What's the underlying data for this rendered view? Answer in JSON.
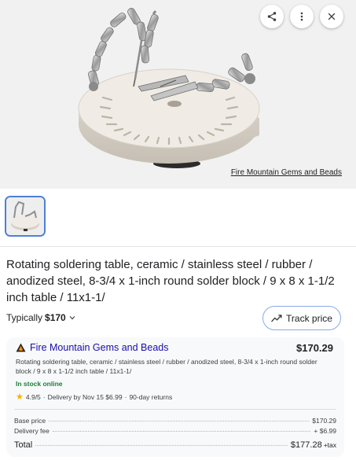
{
  "hero": {
    "image_credit": "Fire Mountain Gems and Beads",
    "actions": [
      {
        "name": "share",
        "icon": "share-icon"
      },
      {
        "name": "more",
        "icon": "more-vert-icon"
      },
      {
        "name": "close",
        "icon": "close-icon"
      }
    ]
  },
  "product": {
    "title": "Rotating soldering table, ceramic / stainless steel / rubber / anodized steel, 8-3/4 x 1-inch round solder block / 9 x 8 x 1-1/2 inch table / 11x1-1/",
    "typically_label": "Typically",
    "typically_price": "$170",
    "track_price_label": "Track price"
  },
  "offer": {
    "seller": "Fire Mountain Gems and Beads",
    "price": "$170.29",
    "description": "Rotating soldering table, ceramic / stainless steel / rubber / anodized steel, 8-3/4 x 1-inch round solder block / 9 x 8 x 1-1/2 inch table / 11x1-1/",
    "stock": "In stock online",
    "rating": "4.9/5",
    "delivery": "Delivery by Nov 15 $6.99",
    "returns": "90-day returns",
    "base_price_label": "Base price",
    "base_price": "$170.29",
    "delivery_fee_label": "Delivery fee",
    "delivery_fee": "+ $6.99",
    "total_label": "Total",
    "total": "$177.28",
    "tax": "+tax"
  },
  "colors": {
    "link": "#1a0dab",
    "in_stock": "#188038",
    "star": "#f4b400",
    "thumb_border": "#4f7fd6"
  }
}
